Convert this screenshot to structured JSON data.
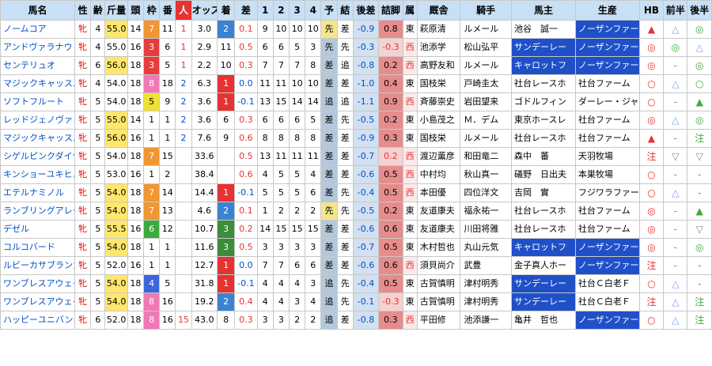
{
  "headers": {
    "name": "馬名",
    "sex": "性",
    "age": "齢",
    "kinryo": "斤量",
    "tosu": "頭",
    "waku": "枠",
    "umaban": "番",
    "ninki": "人",
    "odds": "オッズ",
    "chaku": "着",
    "sa": "差",
    "c1": "1",
    "c2": "2",
    "c3": "3",
    "c4": "4",
    "yoso": "予",
    "kekka": "結",
    "kohan": "後差",
    "tsume": "詰脚",
    "zoku": "属",
    "kyusha": "厩舎",
    "kishu": "騎手",
    "banushi": "馬主",
    "seisan": "生産",
    "hb": "HB",
    "zenhan": "前半",
    "kohan2": "後半"
  },
  "rows": [
    {
      "name": "ノームコア",
      "sex": "牝",
      "age": "4",
      "kinryo": "55.0",
      "kh": true,
      "tosu": "14",
      "waku": "7",
      "w": 7,
      "umaban": "11",
      "ninki": "1",
      "nb": false,
      "odds": "3.0",
      "chaku": "2",
      "c": 2,
      "sa": "0.1",
      "sp": true,
      "c1": "9",
      "c2": "10",
      "c3": "10",
      "c4": "10",
      "yoso": "先",
      "ys": true,
      "kekka": "差",
      "kohan": "-0.9",
      "tsume": "0.8",
      "tt": "b",
      "zoku": "東",
      "zw": false,
      "kyusha": "萩原清",
      "kishu": "ルメール",
      "banushi": "池谷　誠一",
      "bh": false,
      "seisan": "ノーザンファーム",
      "sh": true,
      "hb": "▲",
      "hbc": "red",
      "zen": "△",
      "zc": "blue",
      "ko": "◎",
      "kc": "green"
    },
    {
      "name": "アンドヴァラナウト",
      "sex": "牝",
      "age": "4",
      "kinryo": "55.0",
      "kh": false,
      "tosu": "16",
      "waku": "3",
      "w": 3,
      "umaban": "6",
      "ninki": "1",
      "nb": false,
      "odds": "2.9",
      "chaku": "11",
      "c": 0,
      "sa": "0.5",
      "sp": true,
      "c1": "6",
      "c2": "6",
      "c3": "5",
      "c4": "3",
      "yoso": "先",
      "ys": false,
      "kekka": "先",
      "kohan": "-0.3",
      "tsume": "-0.3",
      "tt": "r",
      "zoku": "西",
      "zw": true,
      "kyusha": "池添学",
      "kishu": "松山弘平",
      "banushi": "サンデーレー",
      "bh": true,
      "seisan": "ノーザンファーム",
      "sh": true,
      "hb": "◎",
      "hbc": "red",
      "zen": "◎",
      "zc": "green",
      "ko": "△",
      "kc": "blue"
    },
    {
      "name": "センテリュオ",
      "sex": "牝",
      "age": "6",
      "kinryo": "56.0",
      "kh": true,
      "tosu": "18",
      "waku": "3",
      "w": 3,
      "umaban": "5",
      "ninki": "1",
      "nb": false,
      "odds": "2.2",
      "chaku": "10",
      "c": 0,
      "sa": "0.3",
      "sp": true,
      "c1": "7",
      "c2": "7",
      "c3": "7",
      "c4": "8",
      "yoso": "差",
      "ys": false,
      "kekka": "追",
      "kohan": "-0.8",
      "tsume": "0.2",
      "tt": "b",
      "zoku": "西",
      "zw": true,
      "kyusha": "高野友和",
      "kishu": "ルメール",
      "banushi": "キャロットフ",
      "bh": true,
      "seisan": "ノーザンファーム",
      "sh": true,
      "hb": "◎",
      "hbc": "red",
      "zen": "-",
      "zc": "gray",
      "ko": "◎",
      "kc": "green"
    },
    {
      "name": "マジックキャッスル",
      "sex": "牝",
      "age": "4",
      "kinryo": "54.0",
      "kh": false,
      "tosu": "18",
      "waku": "8",
      "w": 8,
      "umaban": "18",
      "ninki": "2",
      "nb": true,
      "odds": "6.3",
      "chaku": "1",
      "c": 1,
      "sa": "0.0",
      "sp": false,
      "c1": "11",
      "c2": "11",
      "c3": "10",
      "c4": "10",
      "yoso": "差",
      "ys": false,
      "kekka": "差",
      "kohan": "-1.0",
      "tsume": "0.4",
      "tt": "b",
      "zoku": "東",
      "zw": false,
      "kyusha": "国枝栄",
      "kishu": "戸崎圭太",
      "banushi": "社台レースホ",
      "bh": false,
      "seisan": "社台ファーム",
      "sh": false,
      "hb": "○",
      "hbc": "red",
      "zen": "△",
      "zc": "blue",
      "ko": "○",
      "kc": "green"
    },
    {
      "name": "ソフトフルート",
      "sex": "牝",
      "age": "5",
      "kinryo": "54.0",
      "kh": false,
      "tosu": "18",
      "waku": "5",
      "w": 5,
      "umaban": "9",
      "ninki": "2",
      "nb": true,
      "odds": "3.6",
      "chaku": "1",
      "c": 1,
      "sa": "-0.1",
      "sp": false,
      "c1": "13",
      "c2": "15",
      "c3": "14",
      "c4": "14",
      "yoso": "追",
      "ys": false,
      "kekka": "追",
      "kohan": "-1.1",
      "tsume": "0.9",
      "tt": "b",
      "zoku": "西",
      "zw": true,
      "kyusha": "斉藤崇史",
      "kishu": "岩田望来",
      "banushi": "ゴドルフィン",
      "bh": false,
      "seisan": "ダーレー・ジャパ",
      "sh": false,
      "hb": "○",
      "hbc": "red",
      "zen": "-",
      "zc": "gray",
      "ko": "▲",
      "kc": "green"
    },
    {
      "name": "レッドジェノヴァ",
      "sex": "牝",
      "age": "5",
      "kinryo": "55.0",
      "kh": true,
      "tosu": "14",
      "waku": "1",
      "w": 1,
      "umaban": "1",
      "ninki": "2",
      "nb": true,
      "odds": "3.6",
      "chaku": "6",
      "c": 0,
      "sa": "0.3",
      "sp": true,
      "c1": "6",
      "c2": "6",
      "c3": "6",
      "c4": "5",
      "yoso": "差",
      "ys": false,
      "kekka": "先",
      "kohan": "-0.5",
      "tsume": "0.2",
      "tt": "b",
      "zoku": "東",
      "zw": false,
      "kyusha": "小島茂之",
      "kishu": "Ｍ．デム",
      "banushi": "東京ホースレ",
      "bh": false,
      "seisan": "社台ファーム",
      "sh": false,
      "hb": "◎",
      "hbc": "red",
      "zen": "△",
      "zc": "blue",
      "ko": "◎",
      "kc": "green"
    },
    {
      "name": "マジックキャッスル",
      "sex": "牝",
      "age": "5",
      "kinryo": "56.0",
      "kh": true,
      "tosu": "16",
      "waku": "1",
      "w": 1,
      "umaban": "1",
      "ninki": "2",
      "nb": true,
      "odds": "7.6",
      "chaku": "9",
      "c": 0,
      "sa": "0.6",
      "sp": true,
      "c1": "8",
      "c2": "8",
      "c3": "8",
      "c4": "8",
      "yoso": "差",
      "ys": false,
      "kekka": "差",
      "kohan": "-0.9",
      "tsume": "0.3",
      "tt": "b",
      "zoku": "東",
      "zw": false,
      "kyusha": "国枝栄",
      "kishu": "ルメール",
      "banushi": "社台レースホ",
      "bh": false,
      "seisan": "社台ファーム",
      "sh": false,
      "hb": "▲",
      "hbc": "red",
      "zen": "-",
      "zc": "gray",
      "ko": "注",
      "kc": "green"
    },
    {
      "name": "シゲルピンクダイヤ",
      "sex": "牝",
      "age": "5",
      "kinryo": "54.0",
      "kh": false,
      "tosu": "18",
      "waku": "7",
      "w": 7,
      "umaban": "15",
      "ninki": "",
      "nb": false,
      "odds": "33.6",
      "chaku": "",
      "c": 0,
      "sa": "0.5",
      "sp": true,
      "c1": "13",
      "c2": "11",
      "c3": "11",
      "c4": "11",
      "yoso": "差",
      "ys": false,
      "kekka": "差",
      "kohan": "-0.7",
      "tsume": "0.2",
      "tt": "r",
      "zoku": "西",
      "zw": true,
      "kyusha": "渡辺薫彦",
      "kishu": "和田竜二",
      "banushi": "森中　蕃",
      "bh": false,
      "seisan": "天羽牧場",
      "sh": false,
      "hb": "注",
      "hbc": "red",
      "zen": "▽",
      "zc": "gray",
      "ko": "▽",
      "kc": "gray"
    },
    {
      "name": "キンショーユキヒメ",
      "sex": "牝",
      "age": "5",
      "kinryo": "53.0",
      "kh": false,
      "tosu": "16",
      "waku": "1",
      "w": 1,
      "umaban": "2",
      "ninki": "",
      "nb": false,
      "odds": "38.4",
      "chaku": "",
      "c": 0,
      "sa": "0.6",
      "sp": true,
      "c1": "4",
      "c2": "5",
      "c3": "5",
      "c4": "4",
      "yoso": "差",
      "ys": false,
      "kekka": "差",
      "kohan": "-0.6",
      "tsume": "0.5",
      "tt": "b",
      "zoku": "西",
      "zw": true,
      "kyusha": "中村均",
      "kishu": "秋山真一",
      "banushi": "礒野　日出夫",
      "bh": false,
      "seisan": "本巣牧場",
      "sh": false,
      "hb": "○",
      "hbc": "red",
      "zen": "-",
      "zc": "gray",
      "ko": "-",
      "kc": "gray"
    },
    {
      "name": "エテルナミノル",
      "sex": "牝",
      "age": "5",
      "kinryo": "54.0",
      "kh": true,
      "tosu": "18",
      "waku": "7",
      "w": 7,
      "umaban": "14",
      "ninki": "",
      "nb": false,
      "odds": "14.4",
      "chaku": "1",
      "c": 1,
      "sa": "-0.1",
      "sp": false,
      "c1": "5",
      "c2": "5",
      "c3": "5",
      "c4": "6",
      "yoso": "差",
      "ys": false,
      "kekka": "先",
      "kohan": "-0.4",
      "tsume": "0.5",
      "tt": "b",
      "zoku": "西",
      "zw": true,
      "kyusha": "本田優",
      "kishu": "四位洋文",
      "banushi": "吉岡　實",
      "bh": false,
      "seisan": "フジワラファーム",
      "sh": false,
      "hb": "○",
      "hbc": "red",
      "zen": "△",
      "zc": "blue",
      "ko": "-",
      "kc": "gray"
    },
    {
      "name": "ランブリングアレー",
      "sex": "牝",
      "age": "5",
      "kinryo": "54.0",
      "kh": true,
      "tosu": "18",
      "waku": "7",
      "w": 7,
      "umaban": "13",
      "ninki": "",
      "nb": false,
      "odds": "4.6",
      "chaku": "2",
      "c": 2,
      "sa": "0.1",
      "sp": true,
      "c1": "1",
      "c2": "2",
      "c3": "2",
      "c4": "2",
      "yoso": "先",
      "ys": true,
      "kekka": "先",
      "kohan": "-0.5",
      "tsume": "0.2",
      "tt": "b",
      "zoku": "東",
      "zw": false,
      "kyusha": "友道康夫",
      "kishu": "福永祐一",
      "banushi": "社台レースホ",
      "bh": false,
      "seisan": "社台ファーム",
      "sh": false,
      "hb": "◎",
      "hbc": "red",
      "zen": "-",
      "zc": "gray",
      "ko": "▲",
      "kc": "green"
    },
    {
      "name": "デゼル",
      "sex": "牝",
      "age": "5",
      "kinryo": "55.5",
      "kh": true,
      "tosu": "16",
      "waku": "6",
      "w": 6,
      "umaban": "12",
      "ninki": "",
      "nb": false,
      "odds": "10.7",
      "chaku": "3",
      "c": 3,
      "sa": "0.2",
      "sp": true,
      "c1": "14",
      "c2": "15",
      "c3": "15",
      "c4": "15",
      "yoso": "差",
      "ys": false,
      "kekka": "差",
      "kohan": "-0.6",
      "tsume": "0.6",
      "tt": "b",
      "zoku": "東",
      "zw": false,
      "kyusha": "友道康夫",
      "kishu": "川田将雅",
      "banushi": "社台レースホ",
      "bh": false,
      "seisan": "社台ファーム",
      "sh": false,
      "hb": "◎",
      "hbc": "red",
      "zen": "-",
      "zc": "gray",
      "ko": "▽",
      "kc": "gray"
    },
    {
      "name": "コルコバード",
      "sex": "牝",
      "age": "5",
      "kinryo": "54.0",
      "kh": true,
      "tosu": "18",
      "waku": "1",
      "w": 1,
      "umaban": "1",
      "ninki": "",
      "nb": false,
      "odds": "11.6",
      "chaku": "3",
      "c": 3,
      "sa": "0.5",
      "sp": true,
      "c1": "3",
      "c2": "3",
      "c3": "3",
      "c4": "3",
      "yoso": "差",
      "ys": false,
      "kekka": "差",
      "kohan": "-0.7",
      "tsume": "0.5",
      "tt": "b",
      "zoku": "東",
      "zw": false,
      "kyusha": "木村哲也",
      "kishu": "丸山元気",
      "banushi": "キャロットフ",
      "bh": true,
      "seisan": "ノーザンファーム",
      "sh": true,
      "hb": "◎",
      "hbc": "red",
      "zen": "-",
      "zc": "gray",
      "ko": "◎",
      "kc": "green"
    },
    {
      "name": "ルビーカサブランカ",
      "sex": "牝",
      "age": "5",
      "kinryo": "52.0",
      "kh": false,
      "tosu": "16",
      "waku": "1",
      "w": 1,
      "umaban": "1",
      "ninki": "",
      "nb": false,
      "odds": "12.7",
      "chaku": "1",
      "c": 1,
      "sa": "0.0",
      "sp": false,
      "c1": "7",
      "c2": "7",
      "c3": "6",
      "c4": "6",
      "yoso": "差",
      "ys": false,
      "kekka": "差",
      "kohan": "-0.6",
      "tsume": "0.6",
      "tt": "b",
      "zoku": "西",
      "zw": true,
      "kyusha": "須貝尚介",
      "kishu": "武豊",
      "banushi": "金子真人ホー",
      "bh": false,
      "seisan": "ノーザンファーム",
      "sh": true,
      "hb": "注",
      "hbc": "red",
      "zen": "-",
      "zc": "gray",
      "ko": "-",
      "kc": "gray"
    },
    {
      "name": "ワンブレスアウェイ",
      "sex": "牝",
      "age": "5",
      "kinryo": "54.0",
      "kh": true,
      "tosu": "18",
      "waku": "4",
      "w": 4,
      "umaban": "5",
      "ninki": "",
      "nb": false,
      "odds": "31.8",
      "chaku": "1",
      "c": 1,
      "sa": "-0.1",
      "sp": false,
      "c1": "4",
      "c2": "4",
      "c3": "4",
      "c4": "3",
      "yoso": "追",
      "ys": false,
      "kekka": "先",
      "kohan": "-0.4",
      "tsume": "0.5",
      "tt": "b",
      "zoku": "東",
      "zw": false,
      "kyusha": "古賀慎明",
      "kishu": "津村明秀",
      "banushi": "サンデーレー",
      "bh": true,
      "seisan": "社台Ｃ白老Ｆ",
      "sh": false,
      "hb": "○",
      "hbc": "red",
      "zen": "△",
      "zc": "blue",
      "ko": "-",
      "kc": "gray"
    },
    {
      "name": "ワンブレスアウェイ",
      "sex": "牝",
      "age": "5",
      "kinryo": "54.0",
      "kh": true,
      "tosu": "18",
      "waku": "8",
      "w": 8,
      "umaban": "16",
      "ninki": "",
      "nb": false,
      "odds": "19.2",
      "chaku": "2",
      "c": 2,
      "sa": "0.4",
      "sp": true,
      "c1": "4",
      "c2": "4",
      "c3": "3",
      "c4": "4",
      "yoso": "追",
      "ys": false,
      "kekka": "先",
      "kohan": "-0.1",
      "tsume": "-0.3",
      "tt": "r",
      "zoku": "東",
      "zw": false,
      "kyusha": "古賀慎明",
      "kishu": "津村明秀",
      "banushi": "サンデーレー",
      "bh": true,
      "seisan": "社台Ｃ白老Ｆ",
      "sh": false,
      "hb": "注",
      "hbc": "red",
      "zen": "△",
      "zc": "blue",
      "ko": "注",
      "kc": "green"
    },
    {
      "name": "ハッピーユニバンス",
      "sex": "牝",
      "age": "6",
      "kinryo": "52.0",
      "kh": false,
      "tosu": "18",
      "waku": "8",
      "w": 8,
      "umaban": "16",
      "ninki": "15",
      "nb": false,
      "odds": "43.0",
      "chaku": "8",
      "c": 0,
      "sa": "0.3",
      "sp": true,
      "c1": "3",
      "c2": "3",
      "c3": "2",
      "c4": "2",
      "yoso": "追",
      "ys": false,
      "kekka": "差",
      "kohan": "-0.8",
      "tsume": "0.3",
      "tt": "b",
      "zoku": "西",
      "zw": true,
      "kyusha": "平田修",
      "kishu": "池添謙一",
      "banushi": "亀井　哲也",
      "bh": false,
      "seisan": "ノーザンファーム",
      "sh": true,
      "hb": "○",
      "hbc": "red",
      "zen": "△",
      "zc": "blue",
      "ko": "注",
      "kc": "green"
    }
  ]
}
